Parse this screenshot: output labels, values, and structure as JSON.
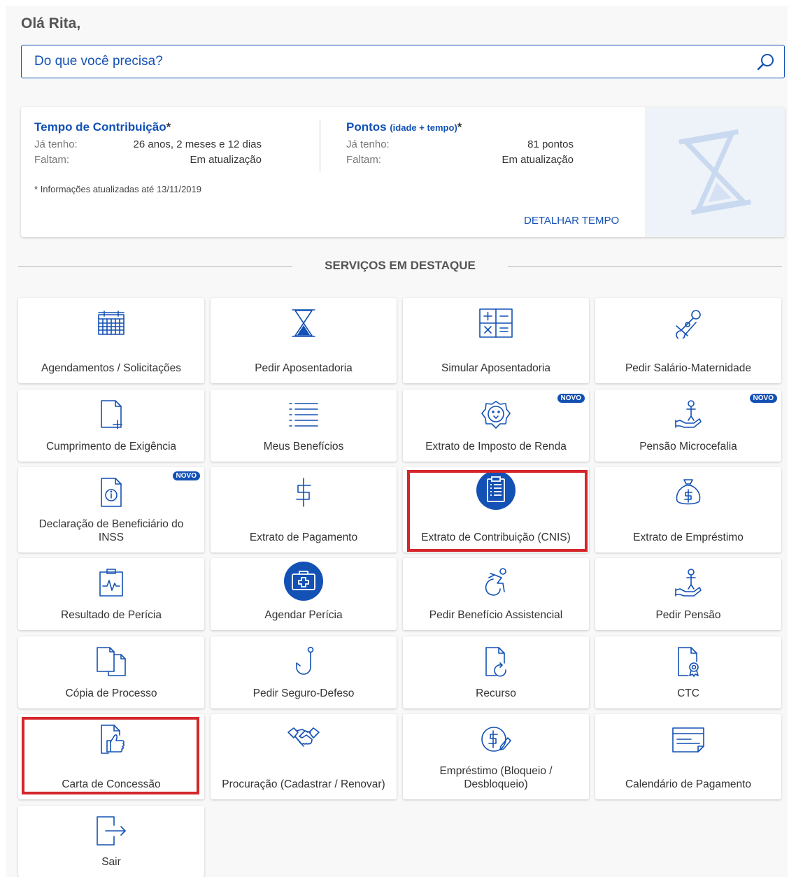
{
  "greeting": "Olá Rita,",
  "search": {
    "placeholder": "Do que você precisa?",
    "icon": "search-icon"
  },
  "contribution_card": {
    "tempo_title": "Tempo de Contribuição",
    "tempo_star": "*",
    "ja_tenho_label": "Já tenho:",
    "tempo_ja_tenho": "26 anos, 2 meses e 12 dias",
    "faltam_label": "Faltam:",
    "tempo_faltam": "Em atualização",
    "pontos_title": "Pontos",
    "pontos_subtitle": "(idade + tempo)",
    "pontos_star": "*",
    "pontos_ja_tenho": "81 pontos",
    "pontos_faltam": "Em atualização",
    "note_star": "*",
    "note": "Informações atualizadas até 13/11/2019",
    "detail_link": "DETALHAR TEMPO"
  },
  "section_title": "SERVIÇOS EM DESTAQUE",
  "badge_label": "NOVO",
  "colors": {
    "primary": "#1351b4",
    "highlight": "#d4262b",
    "background": "#f8f8f8"
  },
  "tiles": [
    {
      "label": "Agendamentos / Solicitações",
      "icon": "calendar-icon"
    },
    {
      "label": "Pedir Aposentadoria",
      "icon": "hourglass-icon"
    },
    {
      "label": "Simular Aposentadoria",
      "icon": "calculator-icon"
    },
    {
      "label": "Pedir Salário-Maternidade",
      "icon": "pacifier-icon"
    },
    {
      "label": "Cumprimento de Exigência",
      "icon": "document-add-icon"
    },
    {
      "label": "Meus Benefícios",
      "icon": "list-icon"
    },
    {
      "label": "Extrato de Imposto de Renda",
      "icon": "lion-icon",
      "badge": true
    },
    {
      "label": "Pensão Microcefalia",
      "icon": "hand-person-icon",
      "badge": true
    },
    {
      "label": "Declaração de Beneficiário do INSS",
      "icon": "document-info-icon",
      "badge": true
    },
    {
      "label": "Extrato de Pagamento",
      "icon": "dollar-icon"
    },
    {
      "label": "Extrato de Contribuição (CNIS)",
      "icon": "clipboard-icon"
    },
    {
      "label": "Extrato de Empréstimo",
      "icon": "money-bag-icon"
    },
    {
      "label": "Resultado de Perícia",
      "icon": "medical-chart-icon"
    },
    {
      "label": "Agendar Perícia",
      "icon": "medical-kit-icon"
    },
    {
      "label": "Pedir Benefício Assistencial",
      "icon": "wheelchair-icon"
    },
    {
      "label": "Pedir Pensão",
      "icon": "hand-person-icon"
    },
    {
      "label": "Cópia de Processo",
      "icon": "copy-document-icon"
    },
    {
      "label": "Pedir Seguro-Defeso",
      "icon": "fishhook-icon"
    },
    {
      "label": "Recurso",
      "icon": "document-refresh-icon"
    },
    {
      "label": "CTC",
      "icon": "certificate-icon"
    },
    {
      "label": "Carta de Concessão",
      "icon": "document-thumbs-up-icon"
    },
    {
      "label": "Procuração (Cadastrar / Renovar)",
      "icon": "handshake-icon"
    },
    {
      "label": "Empréstimo (Bloqueio / Desbloqueio)",
      "icon": "dollar-edit-icon"
    },
    {
      "label": "Calendário de Pagamento",
      "icon": "payment-calendar-icon"
    },
    {
      "label": "Sair",
      "icon": "logout-icon"
    }
  ]
}
